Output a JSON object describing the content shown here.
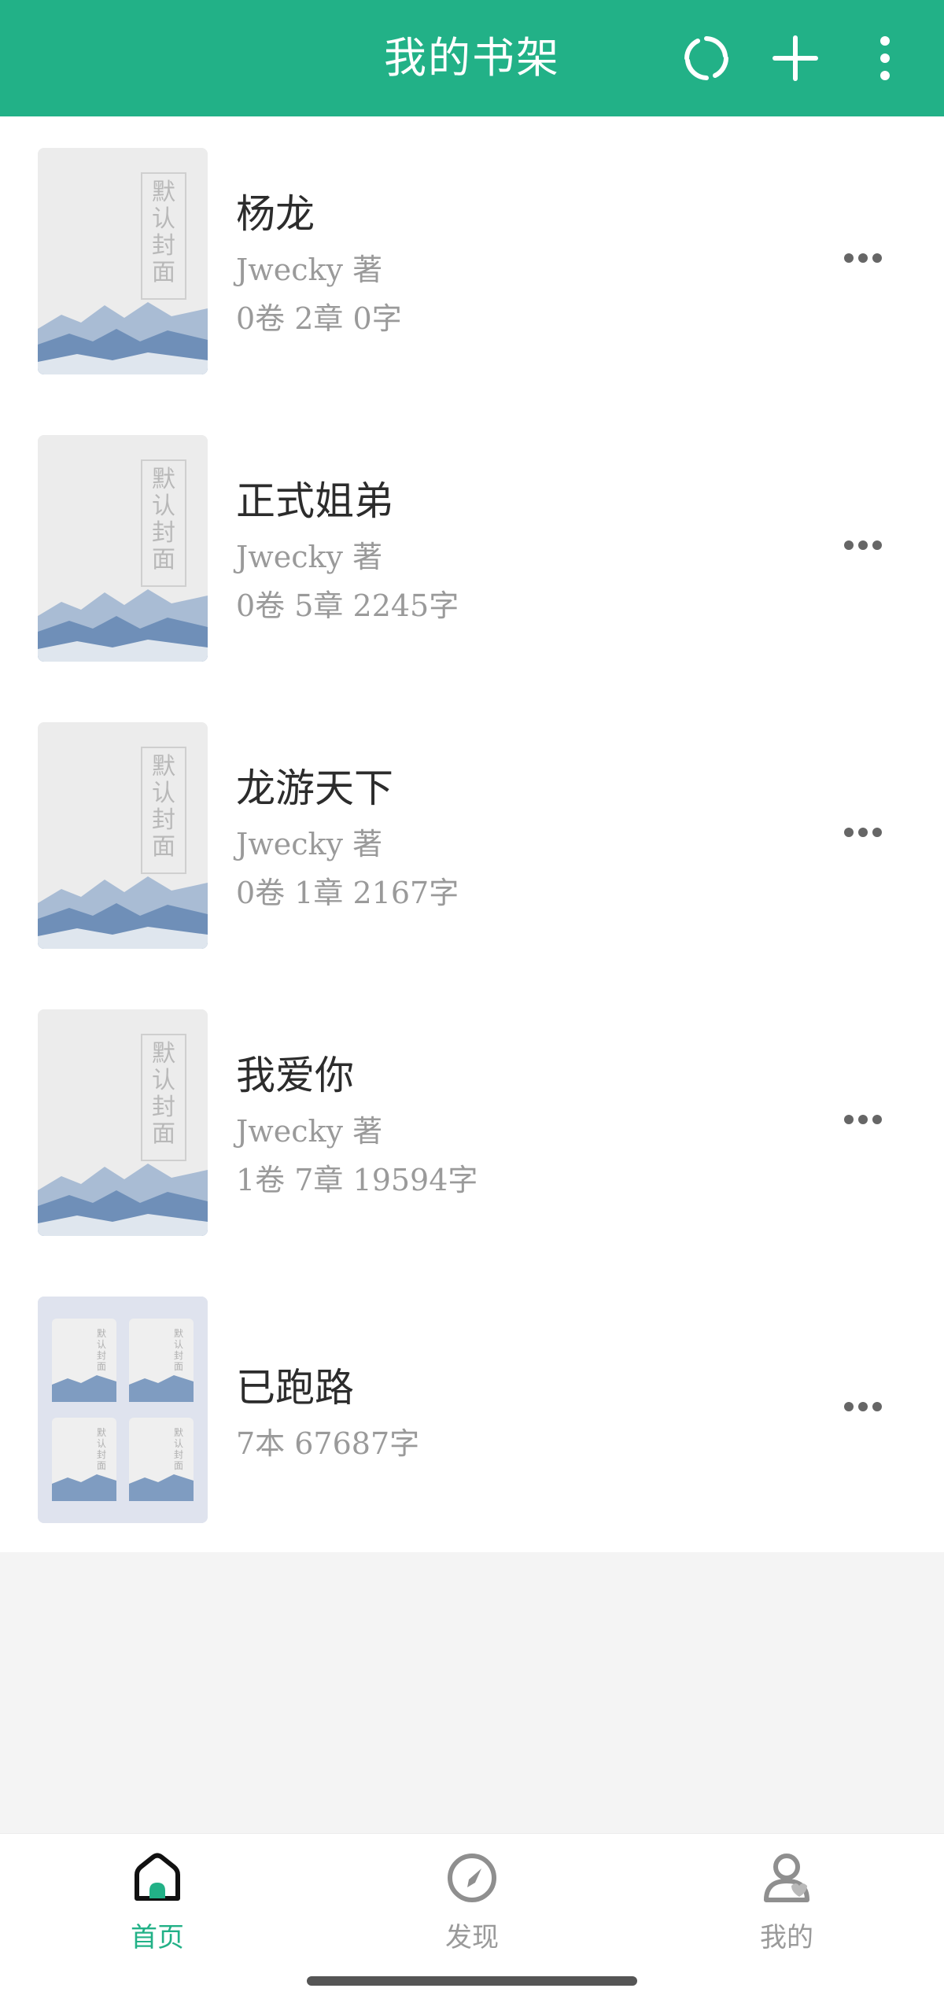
{
  "colors": {
    "accent": "#22b187",
    "title_text": "#2c2c2c",
    "meta_text": "#9a9a9a",
    "group_cover_bg": "#dfe3ee"
  },
  "header": {
    "title": "我的书架",
    "actions": [
      {
        "icon": "refresh-icon"
      },
      {
        "icon": "add-icon"
      },
      {
        "icon": "more-vertical-icon"
      }
    ]
  },
  "books": [
    {
      "title": "杨龙",
      "author": "Jwecky  著",
      "stats": "0卷  2章  0字",
      "cover_text": "默认封面",
      "more_icon": "more-horizontal-icon"
    },
    {
      "title": "正式姐弟",
      "author": "Jwecky  著",
      "stats": "0卷  5章  2245字",
      "cover_text": "默认封面",
      "more_icon": "more-horizontal-icon"
    },
    {
      "title": "龙游天下",
      "author": "Jwecky  著",
      "stats": "0卷  1章  2167字",
      "cover_text": "默认封面",
      "more_icon": "more-horizontal-icon"
    },
    {
      "title": "我爱你",
      "author": "Jwecky  著",
      "stats": "1卷  7章  19594字",
      "cover_text": "默认封面",
      "more_icon": "more-horizontal-icon"
    }
  ],
  "group": {
    "title": "已跑路",
    "stats": "7本  67687字",
    "cover_text": "默认封面",
    "more_icon": "more-horizontal-icon"
  },
  "nav": [
    {
      "label": "首页",
      "icon": "home-icon",
      "active": true
    },
    {
      "label": "发现",
      "icon": "compass-icon",
      "active": false
    },
    {
      "label": "我的",
      "icon": "user-icon",
      "active": false
    }
  ]
}
